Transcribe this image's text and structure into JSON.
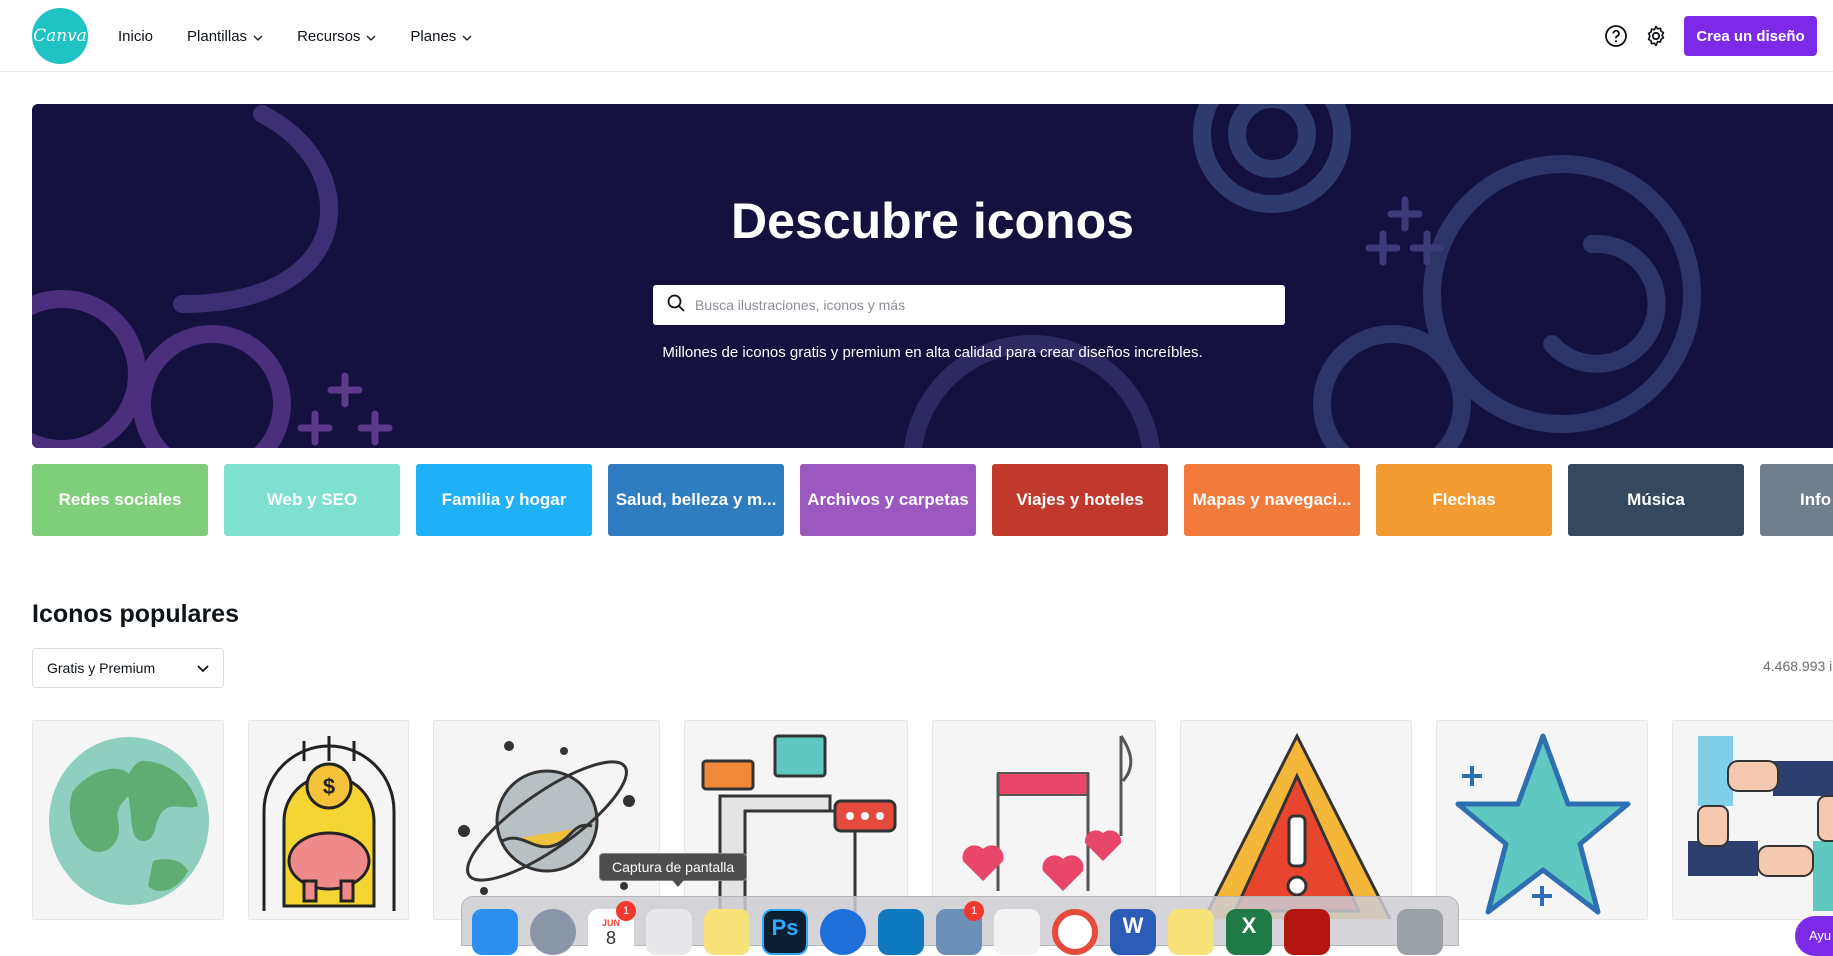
{
  "header": {
    "logo_text": "Canva",
    "nav": [
      {
        "label": "Inicio",
        "has_menu": false
      },
      {
        "label": "Plantillas",
        "has_menu": true
      },
      {
        "label": "Recursos",
        "has_menu": true
      },
      {
        "label": "Planes",
        "has_menu": true
      }
    ],
    "help_icon": "question-circle-icon",
    "settings_icon": "gear-icon",
    "cta_label": "Crea un diseño"
  },
  "hero": {
    "title": "Descubre iconos",
    "search_placeholder": "Busca ilustraciones, iconos y más",
    "subtitle": "Millones de iconos gratis y premium en alta calidad para crear diseños increíbles.",
    "background_color": "#14113f"
  },
  "categories": [
    {
      "label": "Redes sociales",
      "color": "#7fcf7a"
    },
    {
      "label": "Web y SEO",
      "color": "#7ee0cf"
    },
    {
      "label": "Familia y hogar",
      "color": "#1fb0f5"
    },
    {
      "label": "Salud, belleza y m...",
      "color": "#2f7cc0"
    },
    {
      "label": "Archivos y carpetas",
      "color": "#9b59c0"
    },
    {
      "label": "Viajes y hoteles",
      "color": "#c0392b"
    },
    {
      "label": "Mapas y navegaci...",
      "color": "#f27a3b"
    },
    {
      "label": "Flechas",
      "color": "#f29b30"
    },
    {
      "label": "Música",
      "color": "#34495e"
    },
    {
      "label": "Info",
      "color": "#6f7f90"
    }
  ],
  "popular": {
    "title": "Iconos populares",
    "filter_value": "Gratis y Premium",
    "count_text": "4.468.993 i",
    "tiles": [
      {
        "icon": "globe-icon"
      },
      {
        "icon": "piggy-bank-dollar-icon"
      },
      {
        "icon": "planet-icon"
      },
      {
        "icon": "documents-chat-icon"
      },
      {
        "icon": "music-notes-hearts-icon"
      },
      {
        "icon": "warning-triangle-icon"
      },
      {
        "icon": "star-icon"
      },
      {
        "icon": "hands-teamwork-icon"
      }
    ]
  },
  "dock": {
    "tooltip": "Captura de pantalla",
    "calendar_month": "JUN",
    "calendar_day": "8",
    "badge_calendar": "1",
    "badge_mail": "1",
    "apps": [
      "finder-icon",
      "launchpad-icon",
      "calendar-icon",
      "screenshot-icon",
      "notes-icon",
      "photoshop-icon",
      "teamviewer-icon",
      "trello-icon",
      "preview-icon",
      "pages-icon",
      "chrome-icon",
      "word-icon",
      "stickies-icon",
      "excel-icon",
      "acrobat-icon",
      "trash-icon"
    ]
  },
  "help_fab": "Ayu"
}
